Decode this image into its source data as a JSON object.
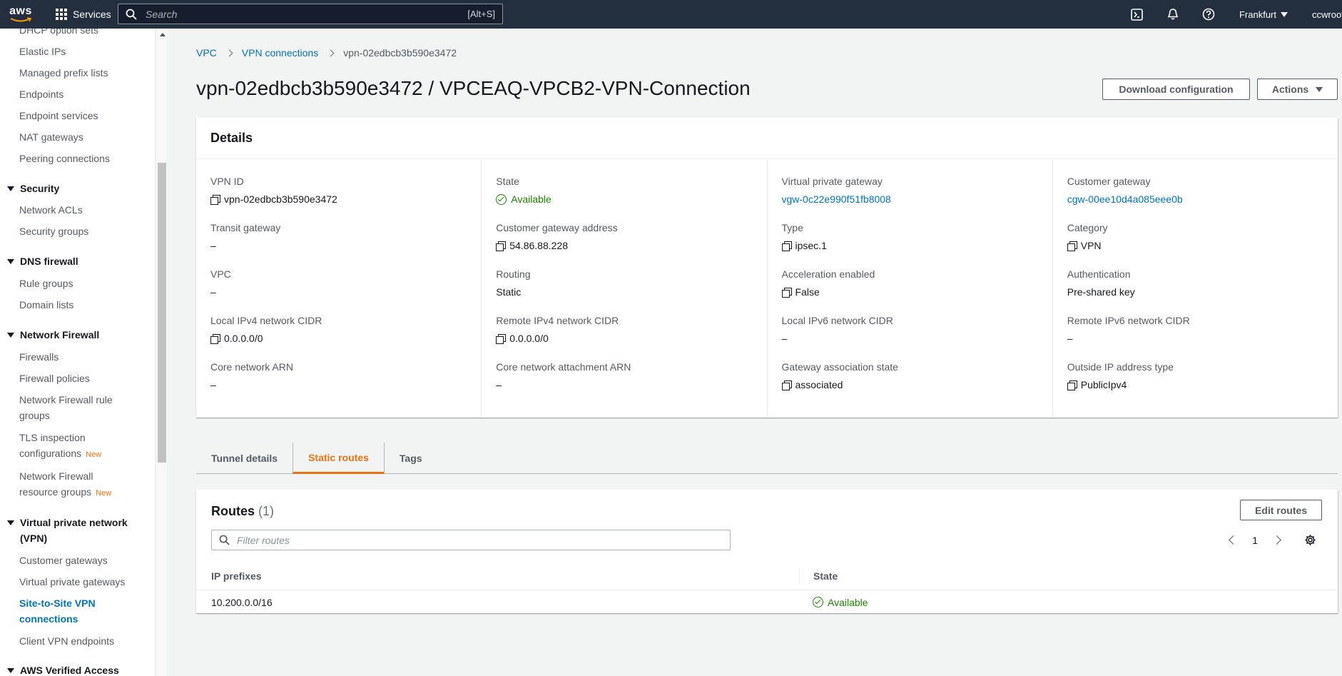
{
  "topnav": {
    "logo": "aws",
    "services_label": "Services",
    "search_placeholder": "Search",
    "search_shortcut": "[Alt+S]",
    "region": "Frankfurt",
    "account": "ccwroot"
  },
  "sidebar": {
    "items_top": [
      "DHCP option sets",
      "Elastic IPs",
      "Managed prefix lists",
      "Endpoints",
      "Endpoint services",
      "NAT gateways",
      "Peering connections"
    ],
    "security": {
      "title": "Security",
      "items": [
        "Network ACLs",
        "Security groups"
      ]
    },
    "dns_firewall": {
      "title": "DNS firewall",
      "items": [
        "Rule groups",
        "Domain lists"
      ]
    },
    "network_firewall": {
      "title": "Network Firewall",
      "items": [
        "Firewalls",
        "Firewall policies",
        "Network Firewall rule groups",
        "TLS inspection configurations",
        "Network Firewall resource groups"
      ],
      "new_badge": "New"
    },
    "vpn": {
      "title": "Virtual private network (VPN)",
      "items": [
        "Customer gateways",
        "Virtual private gateways",
        "Site-to-Site VPN connections",
        "Client VPN endpoints"
      ]
    },
    "verified_access": {
      "title": "AWS Verified Access"
    }
  },
  "breadcrumb": {
    "vpc": "VPC",
    "vpn_connections": "VPN connections",
    "current": "vpn-02edbcb3b590e3472"
  },
  "page": {
    "title": "vpn-02edbcb3b590e3472 / VPCEAQ-VPCB2-VPN-Connection",
    "download_label": "Download configuration",
    "actions_label": "Actions"
  },
  "details": {
    "header": "Details",
    "col1": [
      {
        "k": "VPN ID",
        "v": "vpn-02edbcb3b590e3472"
      },
      {
        "k": "Transit gateway",
        "v": "–"
      },
      {
        "k": "VPC",
        "v": "–"
      },
      {
        "k": "Local IPv4 network CIDR",
        "v": "0.0.0.0/0"
      },
      {
        "k": "Core network ARN",
        "v": "–"
      }
    ],
    "col2": [
      {
        "k": "State",
        "v": "Available"
      },
      {
        "k": "Customer gateway address",
        "v": "54.86.88.228"
      },
      {
        "k": "Routing",
        "v": "Static"
      },
      {
        "k": "Remote IPv4 network CIDR",
        "v": "0.0.0.0/0"
      },
      {
        "k": "Core network attachment ARN",
        "v": "–"
      }
    ],
    "col3": [
      {
        "k": "Virtual private gateway",
        "v": "vgw-0c22e990f51fb8008"
      },
      {
        "k": "Type",
        "v": "ipsec.1"
      },
      {
        "k": "Acceleration enabled",
        "v": "False"
      },
      {
        "k": "Local IPv6 network CIDR",
        "v": "–"
      },
      {
        "k": "Gateway association state",
        "v": "associated"
      }
    ],
    "col4": [
      {
        "k": "Customer gateway",
        "v": "cgw-00ee10d4a085eee0b"
      },
      {
        "k": "Category",
        "v": "VPN"
      },
      {
        "k": "Authentication",
        "v": "Pre-shared key"
      },
      {
        "k": "Remote IPv6 network CIDR",
        "v": "–"
      },
      {
        "k": "Outside IP address type",
        "v": "PublicIpv4"
      }
    ]
  },
  "tabs": [
    "Tunnel details",
    "Static routes",
    "Tags"
  ],
  "routes": {
    "title": "Routes",
    "count": "(1)",
    "edit_label": "Edit routes",
    "filter_placeholder": "Filter routes",
    "page": "1",
    "columns": [
      "IP prefixes",
      "State"
    ],
    "rows": [
      {
        "prefix": "10.200.0.0/16",
        "state": "Available"
      }
    ]
  },
  "colors": {
    "nav_bg": "#232f3e",
    "link": "#0073bb",
    "accent": "#ec7211",
    "success": "#1d8102"
  }
}
